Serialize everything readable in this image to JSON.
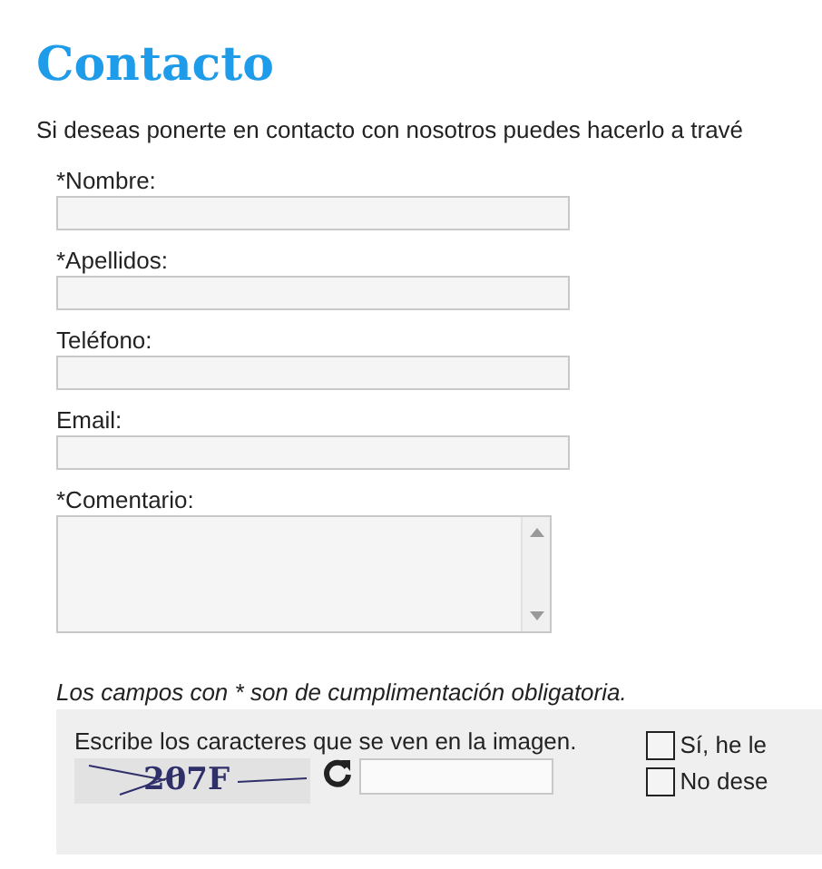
{
  "title": "Contacto",
  "intro": "Si deseas ponerte en contacto con nosotros puedes hacerlo a travé",
  "fields": [
    {
      "label": "*Nombre:",
      "kind": "text"
    },
    {
      "label": "*Apellidos:",
      "kind": "text"
    },
    {
      "label": "Teléfono:",
      "kind": "text"
    },
    {
      "label": "Email:",
      "kind": "text"
    },
    {
      "label": "*Comentario:",
      "kind": "textarea"
    }
  ],
  "note": "Los campos con * son de cumplimentación obligatoria.",
  "captcha": {
    "instruction": "Escribe los caracteres que se ven en la imagen.",
    "code": "207F"
  },
  "checkboxes": [
    {
      "label": "Sí, he le",
      "checked": false
    },
    {
      "label": "No dese",
      "checked": false
    }
  ]
}
